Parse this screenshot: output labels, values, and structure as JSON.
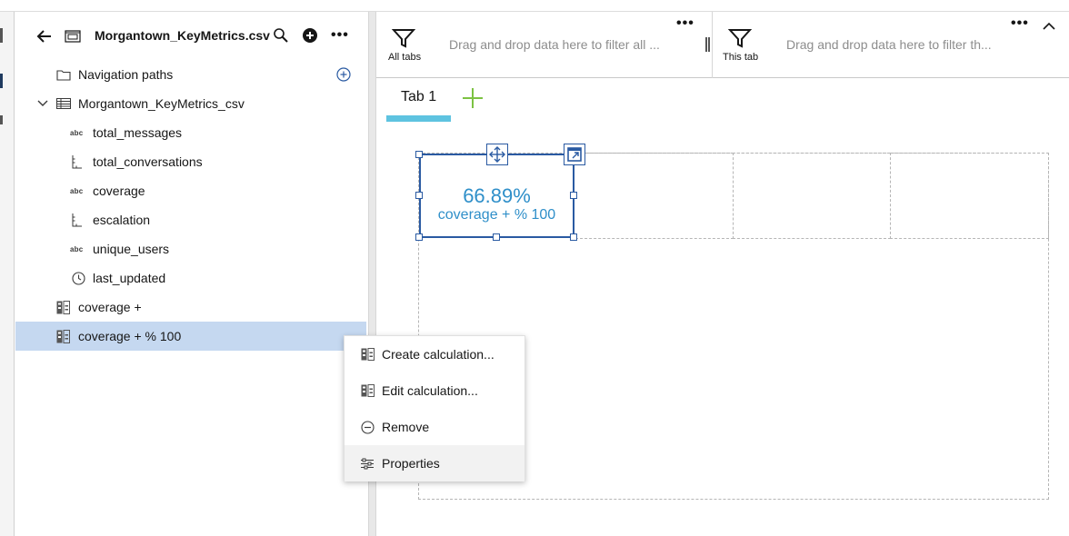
{
  "colors": {
    "accent": "#2a5aa2",
    "kpi_text": "#2f8fc9",
    "tab_underline": "#5ec3e0",
    "selected_row": "#c5d8f0",
    "add_tab": "#7cc242"
  },
  "data_panel": {
    "file_name": "Morgantown_KeyMetrics.csv",
    "back_icon": "arrow-left-icon",
    "file_icon": "csv-file-icon",
    "search_icon": "search-icon",
    "add_icon": "add-circle-icon",
    "more_icon": "overflow-menu-icon",
    "items": [
      {
        "label": "Navigation paths",
        "icon": "folder-icon"
      },
      {
        "label": "Morgantown_KeyMetrics_csv",
        "icon": "table-icon"
      },
      {
        "label": "total_messages",
        "icon": "abc",
        "icon_name": "text-type-icon"
      },
      {
        "label": "total_conversations",
        "icon": "ruler-icon"
      },
      {
        "label": "coverage",
        "icon": "abc",
        "icon_name": "text-type-icon"
      },
      {
        "label": "escalation",
        "icon": "ruler-icon"
      },
      {
        "label": "unique_users",
        "icon": "abc",
        "icon_name": "text-type-icon"
      },
      {
        "label": "last_updated",
        "icon": "clock-icon"
      },
      {
        "label": "coverage +",
        "icon": "calculation-icon"
      },
      {
        "label": "coverage + % 100",
        "icon": "calculation-icon",
        "selected": true
      }
    ]
  },
  "filters": {
    "all_tabs": {
      "label": "All tabs",
      "placeholder": "Drag and drop data here to filter all ...",
      "icon": "filter-icon"
    },
    "this_tab": {
      "label": "This tab",
      "placeholder": "Drag and drop data here to filter th...",
      "icon": "filter-icon"
    }
  },
  "tabs": [
    {
      "label": "Tab 1",
      "active": true
    }
  ],
  "widget": {
    "value": "66.89%",
    "label": "coverage + % 100",
    "move_icon": "move-icon",
    "expand_icon": "expand-icon"
  },
  "context_menu": {
    "items": [
      {
        "label": "Create calculation...",
        "icon": "calculation-icon"
      },
      {
        "label": "Edit calculation...",
        "icon": "calculation-icon"
      },
      {
        "label": "Remove",
        "icon": "remove-circle-icon"
      },
      {
        "label": "Properties",
        "icon": "sliders-icon",
        "hovered": true
      }
    ]
  }
}
